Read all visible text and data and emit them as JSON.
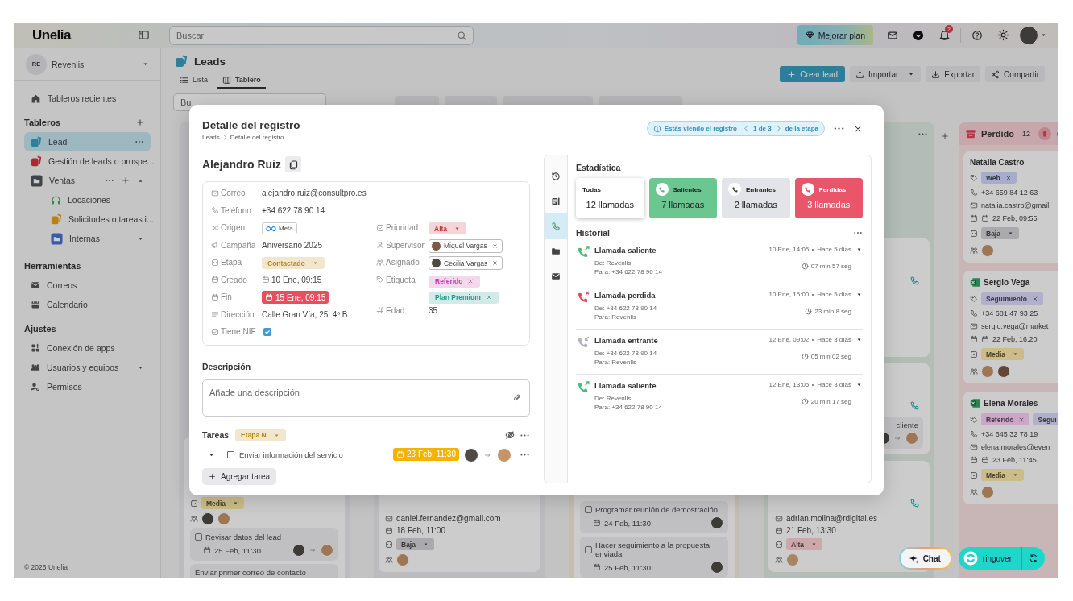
{
  "topbar": {
    "logo": "Unelia",
    "search_placeholder": "Buscar",
    "upgrade_button": "Mejorar plan",
    "notification_count": "2"
  },
  "sidebar": {
    "workspace": {
      "initials": "RE",
      "name": "Revenlis"
    },
    "recent": "Tableros recientes",
    "boards_title": "Tableros",
    "boards": [
      {
        "label": "Lead",
        "kind": "board",
        "color": "#2e7f9b",
        "selected": true
      },
      {
        "label": "Gestión de leads o prospe...",
        "kind": "board",
        "color": "#ad2832",
        "selected": false
      },
      {
        "label": "Ventas",
        "kind": "folder",
        "color": "#404449",
        "selected": false,
        "expanded": true,
        "children": [
          {
            "label": "Locaciones",
            "kind": "headset",
            "color": "#328b55",
            "selected": false
          },
          {
            "label": "Solicitudes o tareas i...",
            "kind": "board",
            "color": "#b68310",
            "selected": false
          },
          {
            "label": "Internas",
            "kind": "folder",
            "color": "#3d59a9",
            "selected": false,
            "expanded": false
          }
        ]
      }
    ],
    "tools_title": "Herramientas",
    "tools": [
      {
        "label": "Correos"
      },
      {
        "label": "Calendario"
      }
    ],
    "settings_title": "Ajustes",
    "settings": [
      {
        "label": "Conexión de apps"
      },
      {
        "label": "Usuarios y equipos",
        "expanded": false
      },
      {
        "label": "Permisos"
      }
    ],
    "footer": "© 2025 Unelia"
  },
  "page": {
    "title": "Leads",
    "views": [
      {
        "label": "Lista",
        "selected": false
      },
      {
        "label": "Tablero",
        "selected": true
      }
    ],
    "actions": [
      {
        "label": "Crear lead",
        "kind": "primary"
      },
      {
        "label": "Importar",
        "kind": "menu"
      },
      {
        "label": "Exportar",
        "kind": "plain"
      },
      {
        "label": "Compartir",
        "kind": "plain"
      }
    ]
  },
  "board": {
    "search_placeholder": "Bu",
    "columns": [
      {
        "color": "#bdbdbf",
        "cards": [
          {
            "priority": {
              "label": "Media",
              "color": "#cbbd8a"
            },
            "avatars": [
              {
                "kind": "photo"
              },
              {
                "kind": "photo"
              }
            ],
            "tasks": [
              {
                "title": "Revisar datos del lead",
                "date": "25 Feb, 11:30",
                "avatars": [
                  {
                    "kind": "photo"
                  },
                  {
                    "kind": "photo"
                  }
                ]
              },
              {
                "title": "Enviar primer correo de contacto"
              }
            ]
          }
        ]
      },
      {
        "color": "#bdbdbf",
        "cards": [
          {
            "email": "daniel.fernandez@gmail.com",
            "date": "18 Feb, 11:00",
            "priority": {
              "label": "Baja",
              "color": "#aaaaad"
            },
            "avatars": [
              {
                "kind": "photo"
              }
            ]
          }
        ]
      },
      {
        "color": "#c4beb1",
        "cards": [
          {
            "tasks": [
              {
                "title": "Programar reunión de demostración",
                "date": "24 Feb, 11:30",
                "avatars": [
                  {
                    "kind": "photo"
                  }
                ]
              },
              {
                "title": "Hacer seguimiento a la propuesta enviada",
                "date": "25 Feb, 11:30",
                "avatars": [
                  {
                    "kind": "photo"
                  }
                ]
              }
            ]
          }
        ]
      },
      {
        "color": "#b5bdb7",
        "cards": [
          {
            "call_icon": true
          },
          {
            "call_icon": true,
            "tasks": [
              {
                "title": "cliente",
                "avatars": [
                  {
                    "kind": "photo"
                  },
                  {
                    "kind": "photo"
                  }
                ]
              }
            ]
          },
          {
            "call_icon": true,
            "email": "adrian.molina@rdigital.es",
            "date": "21 Feb, 13:30",
            "priority": {
              "label": "Alta",
              "color": "#cca8ab"
            },
            "avatars": [
              {
                "kind": "photo"
              }
            ]
          }
        ]
      }
    ],
    "lost_column": {
      "title": "Perdido",
      "count": "12",
      "color": "#c9b6b7",
      "cards": [
        {
          "kind": "lead",
          "name": "Natalia Castro",
          "tags": [
            {
              "label": "Web",
              "color": "#a8add0"
            }
          ],
          "phone": "+34 659 84 12 63",
          "email": "natalia.castro@gmail",
          "date": "22 Feb, 09:55",
          "priority": {
            "label": "Baja",
            "color": "#aaaaad"
          },
          "avatars": [
            {
              "kind": "photo"
            }
          ]
        },
        {
          "kind": "sheet_lead",
          "name": "Sergio Vega",
          "tags": [
            {
              "label": "Seguimiento",
              "color": "#b0b0d0"
            }
          ],
          "phone": "+34 681 47 93 25",
          "email": "sergio.vega@market",
          "date": "22 Feb, 16:20",
          "priority": {
            "label": "Media",
            "color": "#cbbd8a"
          },
          "avatars": [
            {
              "kind": "photo"
            },
            {
              "kind": "photo"
            }
          ]
        },
        {
          "kind": "sheet_lead",
          "name": "Elena Morales",
          "tags": [
            {
              "label": "Referido",
              "color": "#cba6c6"
            },
            {
              "label": "Segui",
              "color": "#b0b0d0"
            }
          ],
          "phone": "+34 645 32 78 19",
          "email": "elena.morales@even",
          "date": "23 Feb, 11:45",
          "priority": {
            "label": "Media",
            "color": "#cbbd8a"
          },
          "avatars": [
            {
              "kind": "photo"
            }
          ]
        }
      ]
    }
  },
  "record_modal": {
    "title": "Detalle del registro",
    "breadcrumb": [
      "Leads",
      "Detalle del registro"
    ],
    "record_nav": {
      "prefix": "Estás viendo el registro",
      "position": "1 de 3",
      "suffix": "de la etapa"
    },
    "name": "Alejandro Ruiz",
    "fields_left": [
      {
        "label": "Correo",
        "kind": "text",
        "value": "alejandro.ruiz@consultpro.es"
      },
      {
        "label": "Teléfono",
        "kind": "text",
        "value": "+34 622 78 90 14"
      },
      {
        "label": "Origen",
        "kind": "source",
        "value": "Meta"
      },
      {
        "label": "Campaña",
        "kind": "text",
        "value": "Aniversario 2025"
      },
      {
        "label": "Etapa",
        "kind": "select",
        "value": "Contactado",
        "color": "#b8880a"
      },
      {
        "label": "Creado",
        "kind": "date",
        "value": "10 Ene, 09:15"
      },
      {
        "label": "Fin",
        "kind": "date_due",
        "value": "15 Ene, 09:15",
        "color": "#e84f5e"
      },
      {
        "label": "Dirección",
        "kind": "text",
        "value": "Calle Gran Vía, 25, 4º B"
      },
      {
        "label": "Tiene NIF",
        "kind": "check",
        "checked": true
      }
    ],
    "fields_right": [
      {
        "label": "Prioridad",
        "kind": "select",
        "value": "Alta",
        "color": "#c8333f"
      },
      {
        "label": "Supervisor",
        "kind": "person",
        "value": "Miquel Vargas"
      },
      {
        "label": "Asignado",
        "kind": "person",
        "value": "Cecilia Vargas"
      },
      {
        "label": "Etiqueta",
        "kind": "tags",
        "tags": [
          {
            "label": "Referido",
            "color": "#c23aa8"
          },
          {
            "label": "Plan Premium",
            "color": "#1f9a8b"
          }
        ]
      },
      {
        "label": "Edad",
        "kind": "text",
        "value": "35"
      }
    ],
    "description": {
      "label": "Descripción",
      "placeholder": "Añade una descripción"
    },
    "tasks": {
      "label": "Tareas",
      "stage": {
        "label": "Etapa N",
        "color": "#b8880a"
      },
      "items": [
        {
          "title": "Enviar información del servicio",
          "checked": false,
          "expanded": false,
          "due": "23 Feb, 11:30",
          "color": "#f5b301"
        }
      ],
      "add_button": "Agregar tarea"
    },
    "activity_tabs": [
      {
        "selected": false
      },
      {
        "selected": false
      },
      {
        "selected": true
      },
      {
        "selected": false
      },
      {
        "selected": false
      }
    ],
    "stats_title": "Estadística",
    "stats": [
      {
        "kind": "all",
        "label": "Todas",
        "value": "12 llamadas",
        "color": "#ffffff",
        "selected": true
      },
      {
        "kind": "outgoing",
        "label": "Salientes",
        "value": "7 llamadas",
        "color": "#6cc690",
        "selected": false
      },
      {
        "kind": "incoming",
        "label": "Entrantes",
        "value": "2 llamadas",
        "color": "#e3e4ea",
        "selected": false
      },
      {
        "kind": "missed",
        "label": "Perdidas",
        "value": "3 llamadas",
        "color": "#e9566a",
        "selected": false
      }
    ],
    "history_title": "Historial",
    "calls": [
      {
        "kind": "outgoing",
        "title": "Llamada saliente",
        "when": "10 Ene, 14:05",
        "ago": "Hace 5 días",
        "from": "De: Revenlis",
        "to": "Para: +34 622 78 90 14",
        "duration": "07 min 57 seg"
      },
      {
        "kind": "missed",
        "title": "Llamada perdida",
        "when": "10 Ene, 15:00",
        "ago": "Hace 5 días",
        "from": "De: +34 622 78 90 14",
        "to": "Para: Revenlis",
        "duration": "23 min 8 seg"
      },
      {
        "kind": "incoming",
        "title": "Llamada entrante",
        "when": "12 Ene, 09:02",
        "ago": "Hace 3 días",
        "from": "De: +34 622 78 90 14",
        "to": "Para: Revenlis",
        "duration": "05 min 02 seg"
      },
      {
        "kind": "outgoing",
        "title": "Llamada saliente",
        "when": "12 Ene, 13:05",
        "ago": "Hace 3 días",
        "from": "De: Revenlis",
        "to": "Para: +34 622 78 90 14",
        "duration": "20 min 17 seg"
      }
    ]
  },
  "floating": {
    "chat": "Chat",
    "ringover": "ringover"
  }
}
